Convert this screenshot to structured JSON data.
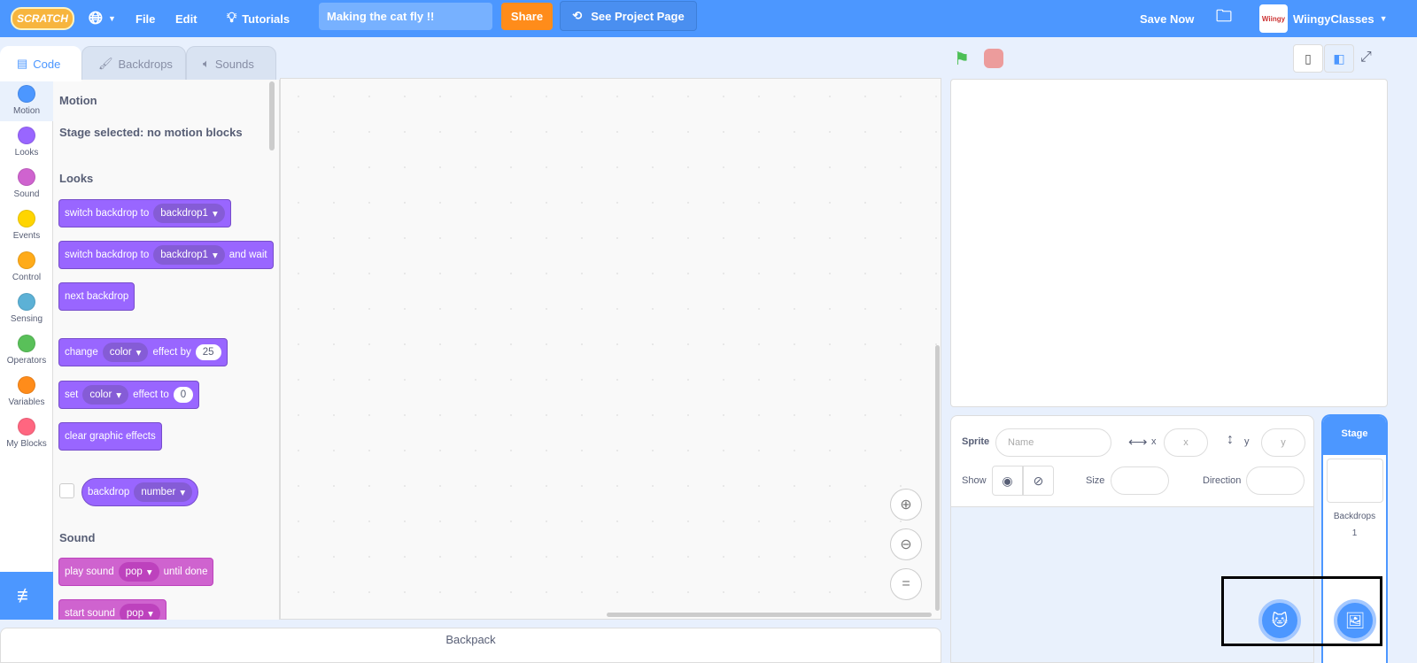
{
  "header": {
    "logo": "Scratch",
    "globe_icon": "globe-icon",
    "file": "File",
    "edit": "Edit",
    "tutorials": "Tutorials",
    "project_title": "Making the cat fly !!",
    "share": "Share",
    "see_project_page": "See Project Page",
    "save_now": "Save Now",
    "username": "WiingyClasses",
    "avatar_text": "Wiingy"
  },
  "tabs": [
    {
      "label": "Code",
      "icon": "code-icon"
    },
    {
      "label": "Backdrops",
      "icon": "brush-icon"
    },
    {
      "label": "Sounds",
      "icon": "speaker-icon"
    }
  ],
  "categories": [
    {
      "label": "Motion",
      "color": "#4c97ff"
    },
    {
      "label": "Looks",
      "color": "#9966ff"
    },
    {
      "label": "Sound",
      "color": "#cf63cf"
    },
    {
      "label": "Events",
      "color": "#ffd500"
    },
    {
      "label": "Control",
      "color": "#ffab19"
    },
    {
      "label": "Sensing",
      "color": "#5cb1d6"
    },
    {
      "label": "Operators",
      "color": "#59c059"
    },
    {
      "label": "Variables",
      "color": "#ff8c1a"
    },
    {
      "label": "My Blocks",
      "color": "#ff6680"
    }
  ],
  "palette": {
    "motion_heading": "Motion",
    "motion_note": "Stage selected: no motion blocks",
    "looks_heading": "Looks",
    "sound_heading": "Sound",
    "b1": {
      "t": "switch backdrop to",
      "d": "backdrop1"
    },
    "b2": {
      "t": "switch backdrop to",
      "d": "backdrop1",
      "t2": "and wait"
    },
    "b3": {
      "t": "next backdrop"
    },
    "b4": {
      "t": "change",
      "d": "color",
      "t2": "effect by",
      "n": "25"
    },
    "b5": {
      "t": "set",
      "d": "color",
      "t2": "effect to",
      "n": "0"
    },
    "b6": {
      "t": "clear graphic effects"
    },
    "b7": {
      "t": "backdrop",
      "d": "number"
    },
    "b8": {
      "t": "play sound",
      "d": "pop",
      "t2": "until done"
    },
    "b9": {
      "t": "start sound",
      "d": "pop"
    }
  },
  "backpack": "Backpack",
  "sprite_info": {
    "sprite": "Sprite",
    "name_placeholder": "Name",
    "x": "x",
    "x_placeholder": "x",
    "y": "y",
    "y_placeholder": "y",
    "show": "Show",
    "size": "Size",
    "direction": "Direction"
  },
  "stage_pane": {
    "title": "Stage",
    "backdrops": "Backdrops",
    "count": "1"
  }
}
